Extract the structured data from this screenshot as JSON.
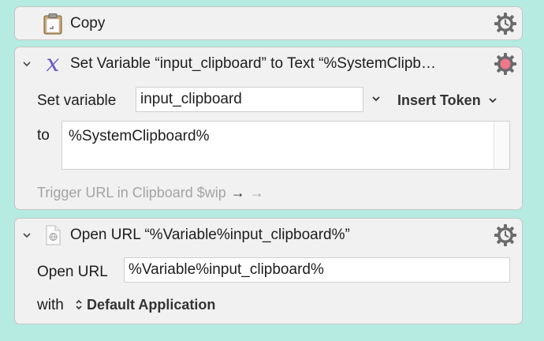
{
  "actions": [
    {
      "title": "Copy",
      "icon": "clipboard-icon"
    },
    {
      "title": "Set Variable “input_clipboard” to Text “%SystemClipb…",
      "icon": "variable-x-icon",
      "set_variable_label": "Set variable",
      "variable_name": "input_clipboard",
      "insert_token_label": "Insert Token",
      "to_label": "to",
      "text_value": "%SystemClipboard%",
      "trigger_text": "Trigger URL in Clipboard $wip",
      "trigger_arrow_active": "→",
      "trigger_arrow_inactive": "→",
      "gear_status_color": "#f0788a"
    },
    {
      "title": "Open URL “%Variable%input_clipboard%”",
      "icon": "url-document-icon",
      "open_url_label": "Open URL",
      "url_value": "%Variable%input_clipboard%",
      "with_label": "with",
      "application": "Default Application"
    }
  ],
  "colors": {
    "background": "#b5ebe1",
    "card": "#f1f1f1",
    "gear": "#6b6b6b"
  }
}
